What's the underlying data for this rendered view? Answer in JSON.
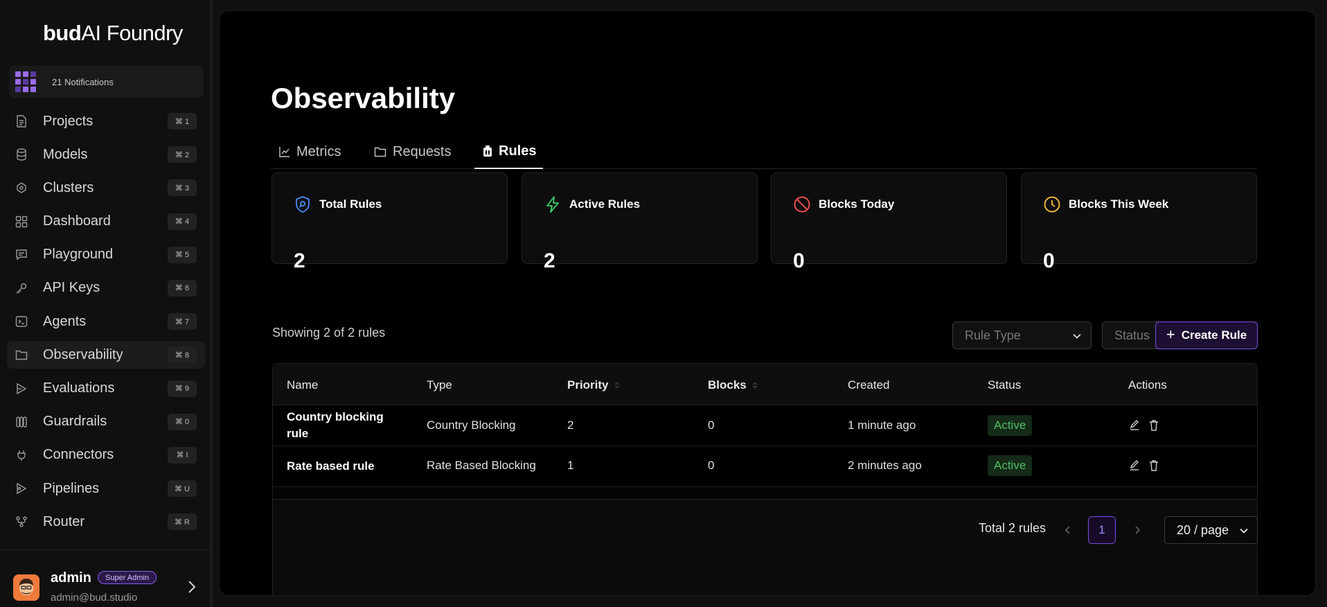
{
  "sidebar": {
    "logo": {
      "bold": "bud",
      "rest": "AI Foundry"
    },
    "notifications": "21 Notifications",
    "items": [
      {
        "label": "Projects",
        "shortcut": "⌘ 1",
        "icon": "document-icon"
      },
      {
        "label": "Models",
        "shortcut": "⌘ 2",
        "icon": "database-icon"
      },
      {
        "label": "Clusters",
        "shortcut": "⌘ 3",
        "icon": "cluster-icon"
      },
      {
        "label": "Dashboard",
        "shortcut": "⌘ 4",
        "icon": "grid-icon"
      },
      {
        "label": "Playground",
        "shortcut": "⌘ 5",
        "icon": "chat-icon"
      },
      {
        "label": "API Keys",
        "shortcut": "⌘ 6",
        "icon": "key-icon"
      },
      {
        "label": "Agents",
        "shortcut": "⌘ 7",
        "icon": "terminal-icon"
      },
      {
        "label": "Observability",
        "shortcut": "⌘ 8",
        "icon": "folder-icon",
        "active": true
      },
      {
        "label": "Evaluations",
        "shortcut": "⌘ 9",
        "icon": "evaluations-icon"
      },
      {
        "label": "Guardrails",
        "shortcut": "⌘ 0",
        "icon": "guardrails-icon"
      },
      {
        "label": "Connectors",
        "shortcut": "⌘ I",
        "icon": "plug-icon"
      },
      {
        "label": "Pipelines",
        "shortcut": "⌘ U",
        "icon": "pipeline-icon"
      },
      {
        "label": "Router",
        "shortcut": "⌘ R",
        "icon": "router-icon"
      }
    ],
    "user": {
      "name": "admin",
      "badge": "Super Admin",
      "email": "admin@bud.studio"
    }
  },
  "main": {
    "title": "Observability",
    "tabs": [
      {
        "label": "Metrics"
      },
      {
        "label": "Requests"
      },
      {
        "label": "Rules",
        "active": true
      }
    ],
    "stats": [
      {
        "label": "Total Rules",
        "value": "2",
        "icon": "shield-search-icon",
        "color": "#4a8cf7"
      },
      {
        "label": "Active Rules",
        "value": "2",
        "icon": "lightning-icon",
        "color": "#3ecf6a"
      },
      {
        "label": "Blocks Today",
        "value": "0",
        "icon": "block-icon",
        "color": "#ef4e4e"
      },
      {
        "label": "Blocks This Week",
        "value": "0",
        "icon": "clock-icon",
        "color": "#f2b43a"
      }
    ],
    "showing": "Showing 2 of 2 rules",
    "filters": {
      "rule_type": "Rule Type",
      "status": "Status"
    },
    "create_label": "Create Rule",
    "table": {
      "columns": [
        "Name",
        "Type",
        "Priority",
        "Blocks",
        "Created",
        "Status",
        "Actions"
      ],
      "rows": [
        {
          "name": "Country blocking rule",
          "type": "Country Blocking",
          "priority": "2",
          "blocks": "0",
          "created": "1 minute ago",
          "status": "Active"
        },
        {
          "name": "Rate based rule",
          "type": "Rate Based Blocking",
          "priority": "1",
          "blocks": "0",
          "created": "2 minutes ago",
          "status": "Active"
        }
      ]
    },
    "pagination": {
      "total": "Total 2 rules",
      "page": "1",
      "size": "20 / page"
    }
  },
  "colors": {
    "accent": "#7b4ee0",
    "active_status": "#4fbf67"
  }
}
